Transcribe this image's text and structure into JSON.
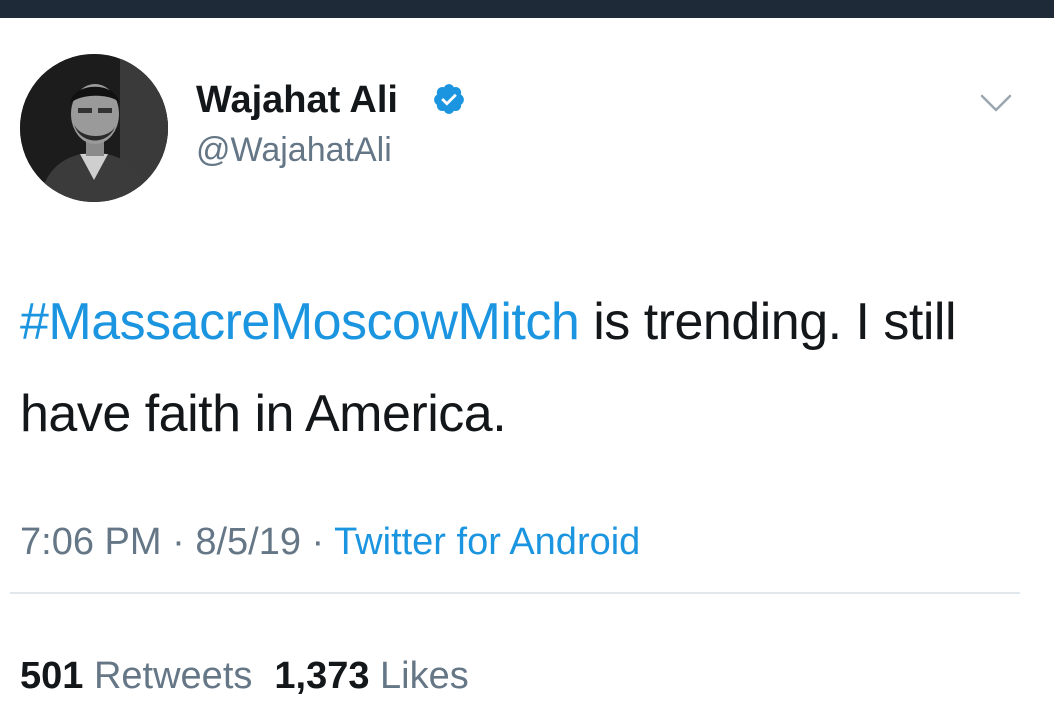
{
  "author": {
    "display_name": "Wajahat Ali",
    "handle": "@WajahatAli",
    "verified": true
  },
  "icons": {
    "verified": "verified-badge-icon",
    "caret": "chevron-down-icon"
  },
  "tweet": {
    "hashtag": "#MassacreMoscowMitch",
    "text_rest": " is trending. I still have faith in America."
  },
  "meta": {
    "time": "7:06 PM",
    "separator": " · ",
    "date": "8/5/19",
    "source": "Twitter for Android"
  },
  "stats": {
    "retweets_count": "501",
    "retweets_label": "Retweets",
    "likes_count": "1,373",
    "likes_label": "Likes"
  },
  "colors": {
    "link": "#1b95e0",
    "text": "#14171a",
    "muted": "#657786",
    "divider": "#e1e8ed",
    "topbar": "#1f2a38"
  }
}
